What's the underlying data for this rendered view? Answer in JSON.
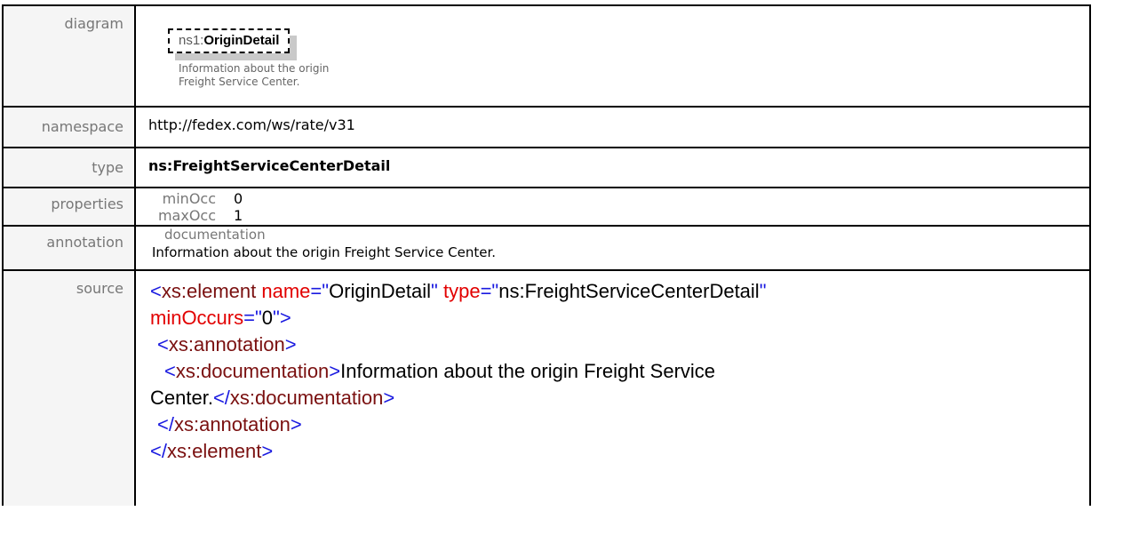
{
  "rows": {
    "diagram": {
      "label": "diagram",
      "element_prefix": "ns1:",
      "element_name": "OriginDetail",
      "note": "Information about the origin Freight Service Center."
    },
    "namespace": {
      "label": "namespace",
      "value": "http://fedex.com/ws/rate/v31"
    },
    "type": {
      "label": "type",
      "value": "ns:FreightServiceCenterDetail"
    },
    "properties": {
      "label": "properties",
      "items": [
        {
          "key": "minOcc",
          "value": "0"
        },
        {
          "key": "maxOcc",
          "value": "1"
        }
      ]
    },
    "annotation": {
      "label": "annotation",
      "doc_label": "documentation",
      "text": "Information about the origin Freight Service Center."
    },
    "source": {
      "label": "source",
      "open_tag": "xs:element",
      "attr_name": "name",
      "attr_name_value": "OriginDetail",
      "attr_type": "type",
      "attr_type_value": "ns:FreightServiceCenterDetail",
      "attr_min": "minOccurs",
      "attr_min_value": "0",
      "annotation_tag": "xs:annotation",
      "documentation_tag": "xs:documentation",
      "doc_text_line1": "Information about the origin Freight Service",
      "doc_text_line2": "Center.",
      "close_documentation": "xs:documentation",
      "close_annotation": "xs:annotation",
      "close_element": "xs:element"
    }
  }
}
